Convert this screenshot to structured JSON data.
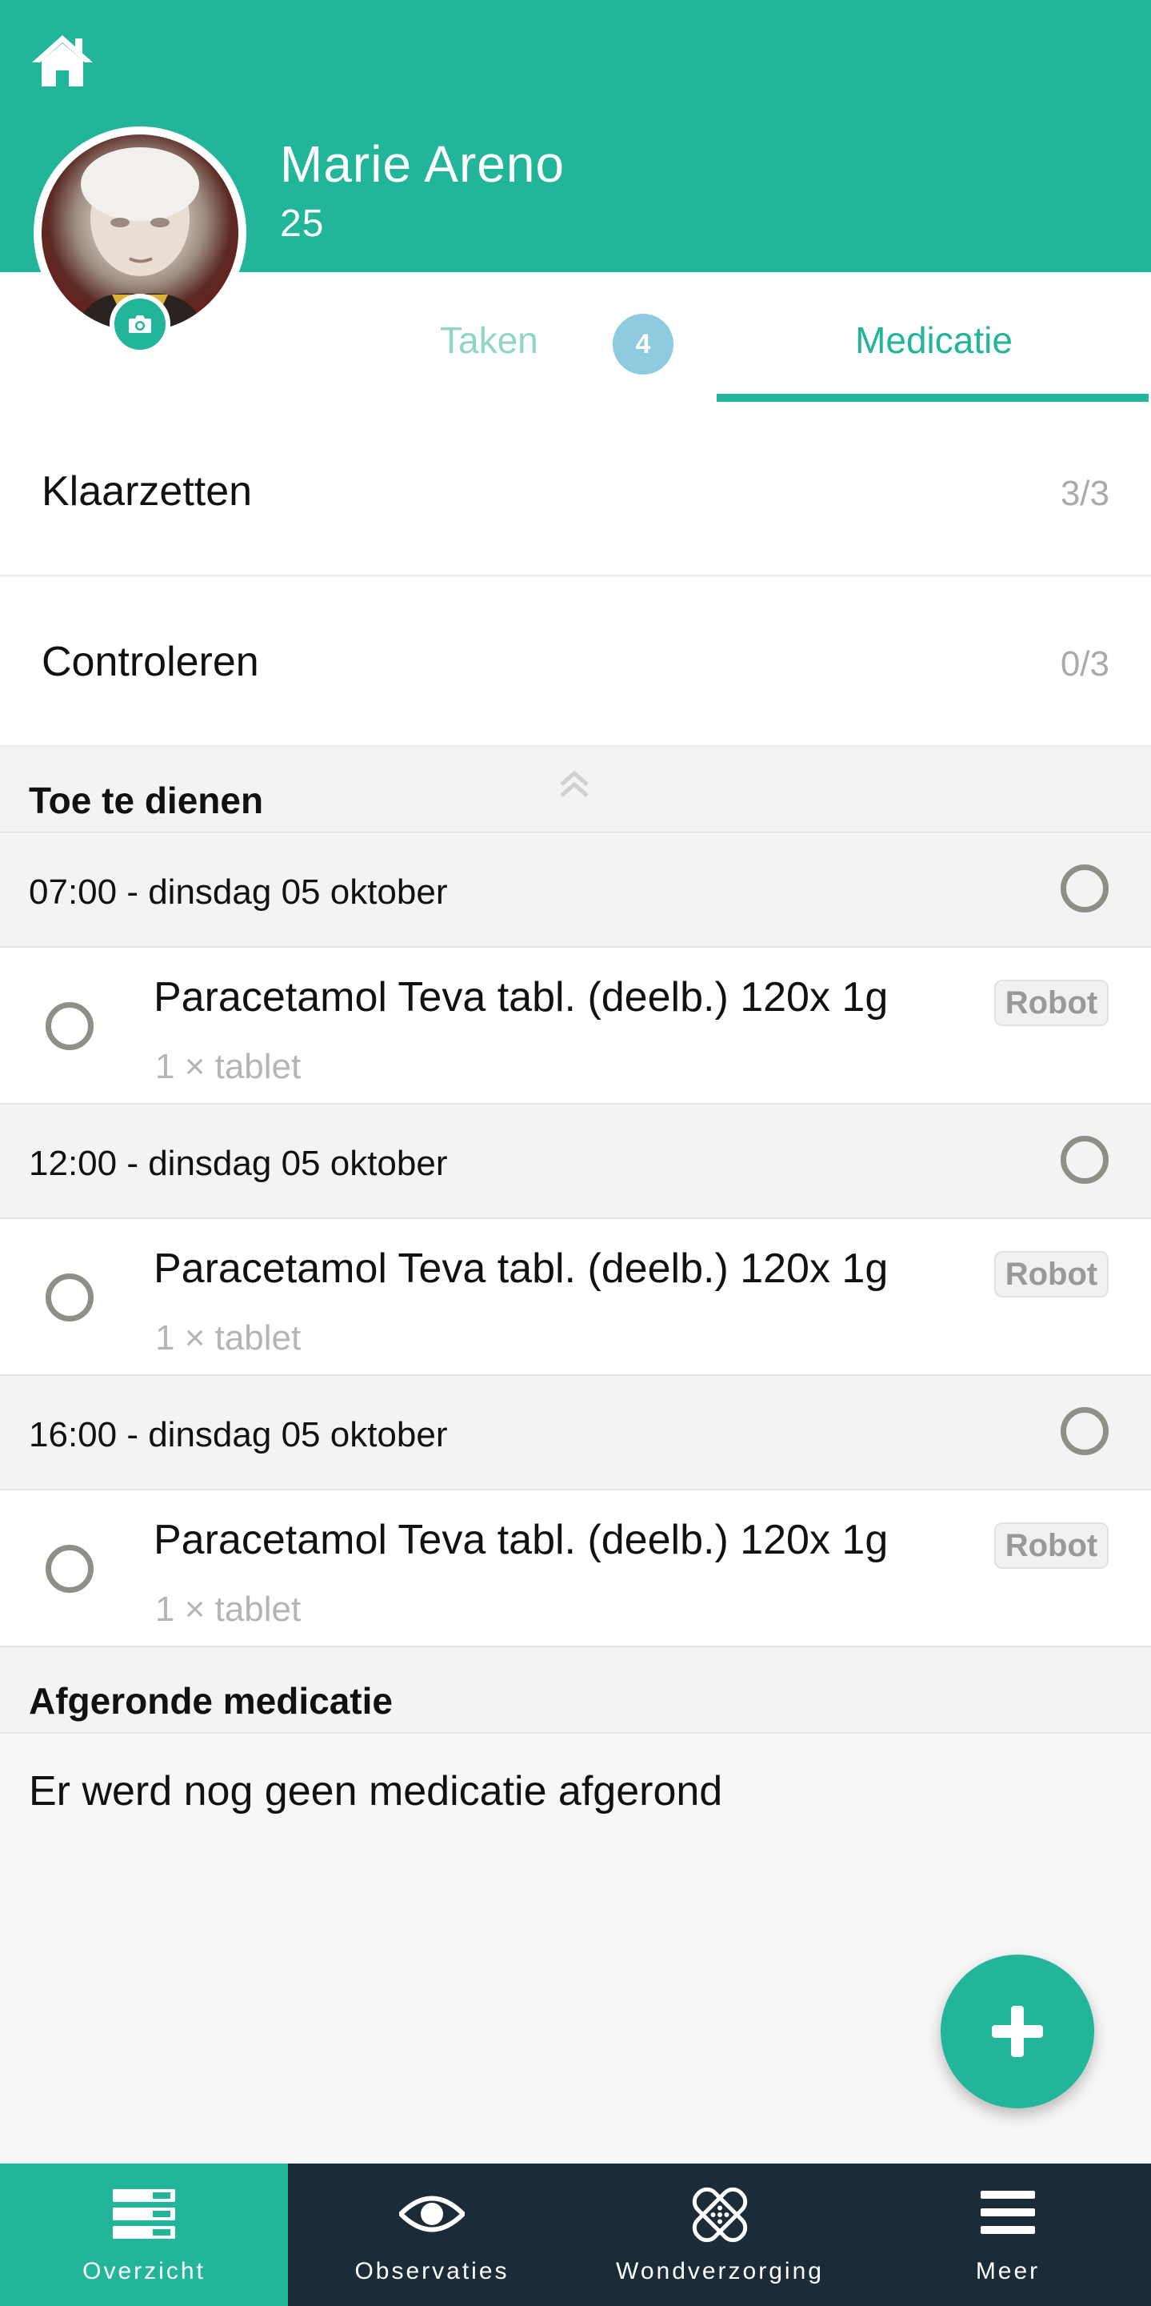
{
  "header": {
    "patient_name": "Marie Areno",
    "room": "25",
    "home_icon": "home-icon",
    "camera_icon": "camera-icon"
  },
  "tabs": {
    "taken_label": "Taken",
    "taken_badge": "4",
    "medicatie_label": "Medicatie",
    "active": "Medicatie"
  },
  "summary": [
    {
      "label": "Klaarzetten",
      "count": "3/3"
    },
    {
      "label": "Controleren",
      "count": "0/3"
    }
  ],
  "to_administer": {
    "title": "Toe te dienen",
    "groups": [
      {
        "time": "07:00 - dinsdag 05 oktober",
        "medication": "Paracetamol Teva tabl. (deelb.) 120x 1g",
        "dose": "1 × tablet",
        "source": "Robot"
      },
      {
        "time": "12:00 - dinsdag 05 oktober",
        "medication": "Paracetamol Teva tabl. (deelb.) 120x 1g",
        "dose": "1 × tablet",
        "source": "Robot"
      },
      {
        "time": "16:00 - dinsdag 05 oktober",
        "medication": "Paracetamol Teva tabl. (deelb.) 120x 1g",
        "dose": "1 × tablet",
        "source": "Robot"
      }
    ]
  },
  "completed": {
    "title": "Afgeronde medicatie",
    "empty_message": "Er werd nog geen medicatie afgerond"
  },
  "bottom_nav": [
    {
      "label": "Overzicht",
      "icon": "overview-icon",
      "active": true
    },
    {
      "label": "Observaties",
      "icon": "eye-icon",
      "active": false
    },
    {
      "label": "Wondverzorging",
      "icon": "bandage-icon",
      "active": false
    },
    {
      "label": "Meer",
      "icon": "menu-icon",
      "active": false
    }
  ],
  "colors": {
    "accent": "#22b59a",
    "nav_background": "#1b2b38",
    "badge": "#8fcbe0",
    "radio": "#8f8f87"
  }
}
